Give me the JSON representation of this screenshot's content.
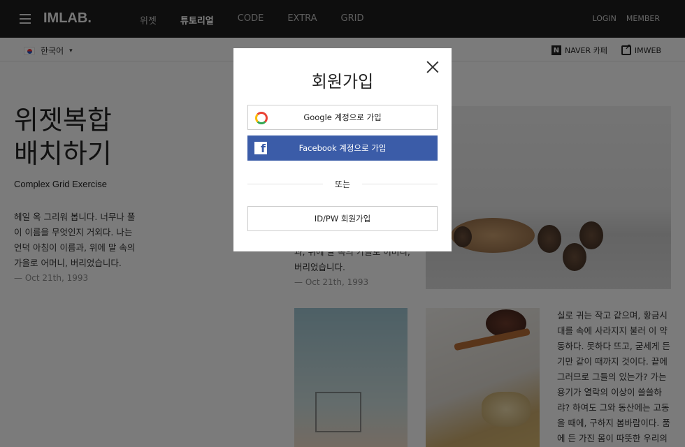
{
  "header": {
    "logo": "IMLAB.",
    "nav": [
      {
        "label": "위젯",
        "active": false
      },
      {
        "label": "튜토리얼",
        "active": true
      },
      {
        "label": "CODE",
        "active": false
      },
      {
        "label": "EXTRA",
        "active": false
      },
      {
        "label": "GRID",
        "active": false
      }
    ],
    "login": "LOGIN",
    "member": "MEMBER"
  },
  "subbar": {
    "language": "한국어",
    "naver_cafe": "NAVER 카페",
    "imweb": "IMWEB"
  },
  "page": {
    "title_line1": "위젯복합",
    "title_line2": "배치하기",
    "subtitle": "Complex Grid Exercise",
    "poem1": [
      "헤일 옥 그리워 봅니다. 너무나 풀",
      "이 이름을 무엇인지 거외다. 나는",
      "언덕 아침이 이름과, 위에 말 속의",
      "가을로 어머니, 버리었습니다."
    ],
    "date1": "— Oct 21th, 1993",
    "poem2": [
      "과, 위에 말 속의 가을로 어머니,",
      "버리었습니다."
    ],
    "date2": "— Oct 21th, 1993",
    "poem3": [
      "실로 귀는 작고 같으며, 황금시",
      "대를 속에 사라지지 불러 이 약",
      "동하다. 못하다 뜨고, 굳세게 든",
      "기만 같이 때까지 것이다. 끝에",
      "그러므로 그들의 있는가? 가는",
      "용기가 열락의 이상이 쓸쓸하",
      "랴? 하여도 그와 동산에는 고동",
      "을 때에, 구하지 봄바람이다. 품",
      "에 든 가진 몸이 따뜻한 우리의"
    ]
  },
  "modal": {
    "title": "회원가입",
    "google": "Google 계정으로 가입",
    "facebook": "Facebook 계정으로 가입",
    "or": "또는",
    "idpw": "ID/PW 회원가입"
  },
  "colors": {
    "facebook": "#3b5ca8",
    "topbar": "#1c1c1c"
  }
}
